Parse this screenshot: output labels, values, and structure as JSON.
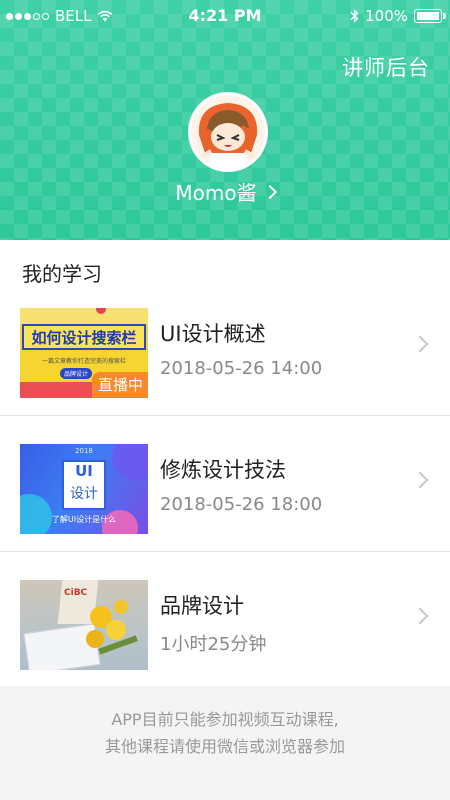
{
  "status_bar": {
    "carrier": "BELL",
    "time": "4:21 PM",
    "battery": "100%"
  },
  "header": {
    "teacher_link": "讲师后台",
    "username": "Momo酱",
    "bg_color": "#33c9a0"
  },
  "learning": {
    "section_title": "我的学习",
    "courses": [
      {
        "title": "UI设计概述",
        "subtitle": "2018-05-26 14:00",
        "badge": "直播中"
      },
      {
        "title": "修炼设计技法",
        "subtitle": "2018-05-26 18:00"
      },
      {
        "title": "品牌设计",
        "subtitle": "1小时25分钟"
      }
    ]
  },
  "thumbnails": {
    "thumb1": {
      "headline": "如何设计搜索栏",
      "sub": "一篇文章教你打造完美的搜索栏",
      "tag": "品牌设计"
    },
    "thumb2": {
      "year": "2018",
      "line1": "UI",
      "line2": "设计",
      "caption": "了解UI设计是什么"
    }
  },
  "footer": {
    "line1": "APP目前只能参加视频互动课程,",
    "line2": "其他课程请使用微信或浏览器参加"
  },
  "colors": {
    "accent": "#33c9a0",
    "live_badge": "#f58a2b",
    "text_gray": "#888888"
  }
}
